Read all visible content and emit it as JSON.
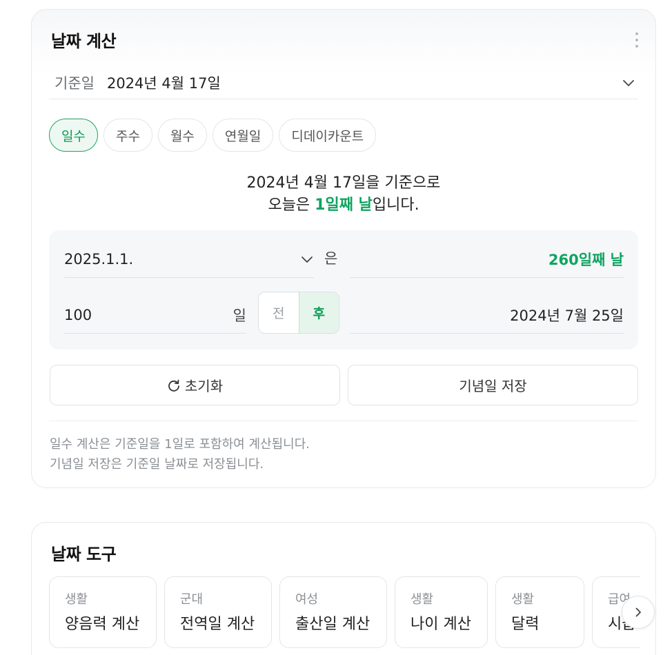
{
  "calc": {
    "title": "날짜 계산",
    "base_label": "기준일",
    "base_value": "2024년 4월 17일",
    "tabs": [
      {
        "label": "일수",
        "active": true
      },
      {
        "label": "주수"
      },
      {
        "label": "월수"
      },
      {
        "label": "연월일"
      },
      {
        "label": "디데이카운트"
      }
    ],
    "summary_line1": "2024년 4월 17일을 기준으로",
    "summary_prefix": "오늘은 ",
    "summary_highlight": "1일째 날",
    "summary_suffix": "입니다.",
    "date_input": "2025.1.1.",
    "particle": "은",
    "date_result": "260일째 날",
    "days_value": "100",
    "days_unit": "일",
    "before_label": "전",
    "after_label": "후",
    "after_result": "2024년 7월 25일",
    "reset_label": "초기화",
    "save_label": "기념일 저장",
    "note1": "일수 계산은 기준일을 1일로 포함하여 계산됩니다.",
    "note2": "기념일 저장은 기준일 날짜로 저장됩니다."
  },
  "tools": {
    "title": "날짜 도구",
    "items": [
      {
        "category": "생활",
        "name": "양음력 계산"
      },
      {
        "category": "군대",
        "name": "전역일 계산"
      },
      {
        "category": "여성",
        "name": "출산일 계산"
      },
      {
        "category": "생활",
        "name": "나이 계산"
      },
      {
        "category": "생활",
        "name": "달력"
      },
      {
        "category": "급여",
        "name": "시급"
      }
    ]
  },
  "colors": {
    "accent_green": "#0fa460",
    "active_tab_bg": "#eef8f2",
    "border": "#e6e8eb"
  },
  "icons": {
    "more": "more-vertical-icon",
    "dropdown": "chevron-down-icon",
    "reset": "refresh-icon",
    "next": "chevron-right-icon"
  }
}
